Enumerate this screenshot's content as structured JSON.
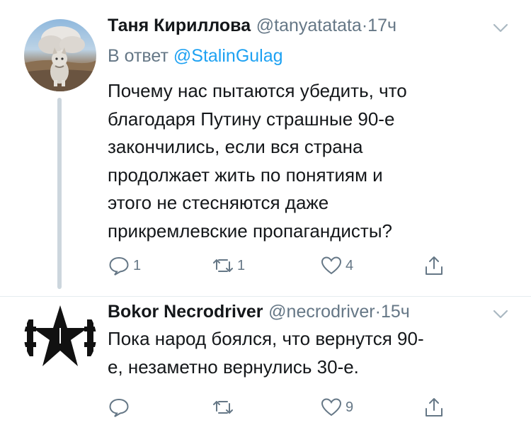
{
  "tweets": [
    {
      "name": "Таня Кириллова",
      "handle": "@tanyatatata",
      "separator": "·",
      "time": "17ч",
      "reply_prefix": "В ответ",
      "reply_mention": "@StalinGulag",
      "text": "Почему нас пытаются убедить, что\nблагодаря Путину страшные 90-е\nзакончились, если вся страна\nпродолжает жить по понятиям и\nэтого не стесняются даже\nприкремлевские пропагандисты?",
      "replies": "1",
      "retweets": "1",
      "likes": "4"
    },
    {
      "name": "Bokor Necrodriver",
      "handle": "@necrodriver",
      "separator": "·",
      "time": "15ч",
      "text": "Пока народ боялся, что вернутся 90-\nе, незаметно вернулись 30-е.",
      "replies": "",
      "retweets": "",
      "likes": "9"
    }
  ],
  "icons": {
    "reply": "reply-icon",
    "retweet": "retweet-icon",
    "like": "heart-icon",
    "share": "share-icon",
    "caret": "chevron-down-icon"
  },
  "colors": {
    "text": "#14171a",
    "secondary": "#657786",
    "link": "#1da1f2",
    "thread_line": "#ccd6dd"
  }
}
